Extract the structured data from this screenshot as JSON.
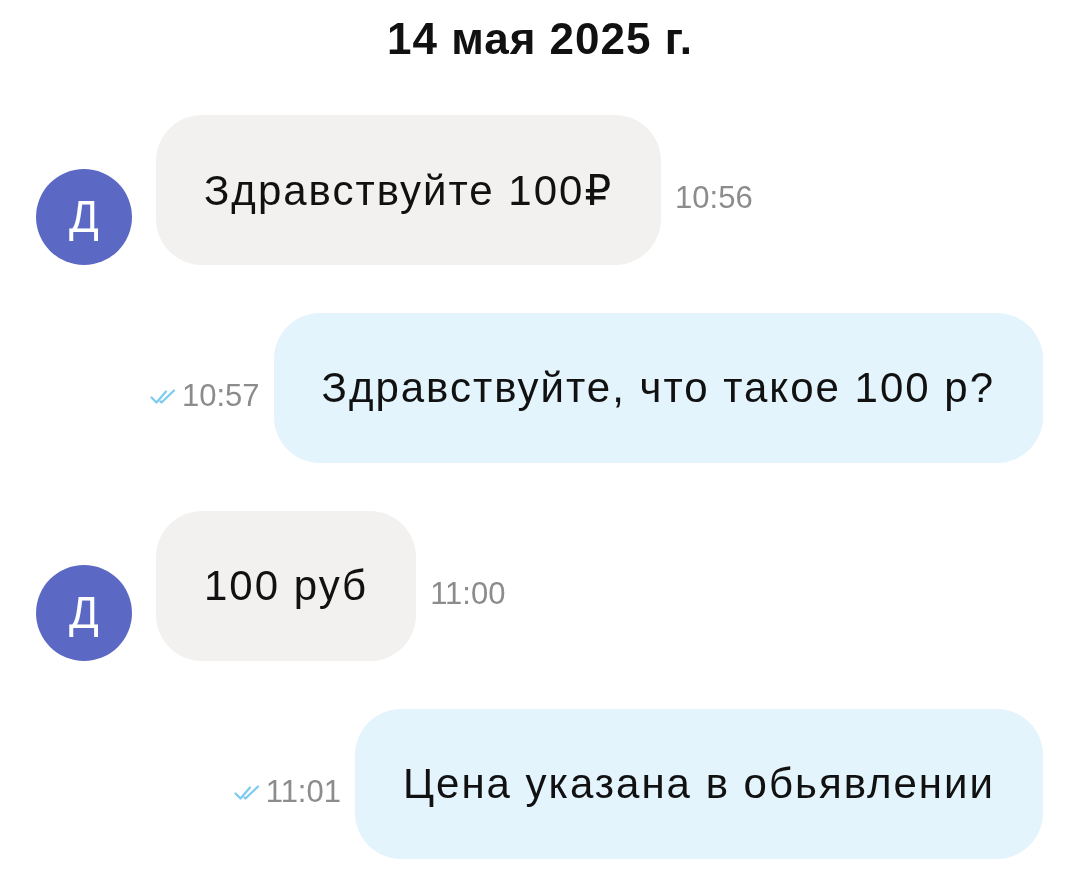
{
  "date": "14 мая 2025 г.",
  "messages": [
    {
      "kind": "incoming",
      "avatar": "Д",
      "text": "Здравствуйте 100₽",
      "time": "10:56"
    },
    {
      "kind": "outgoing",
      "text": "Здравствуйте, что такое 100 р?",
      "time": "10:57",
      "read": true
    },
    {
      "kind": "incoming",
      "avatar": "Д",
      "text": "100 руб",
      "time": "11:00"
    },
    {
      "kind": "outgoing",
      "text": "Цена указана в обьявлении",
      "time": "11:01",
      "read": true
    }
  ]
}
